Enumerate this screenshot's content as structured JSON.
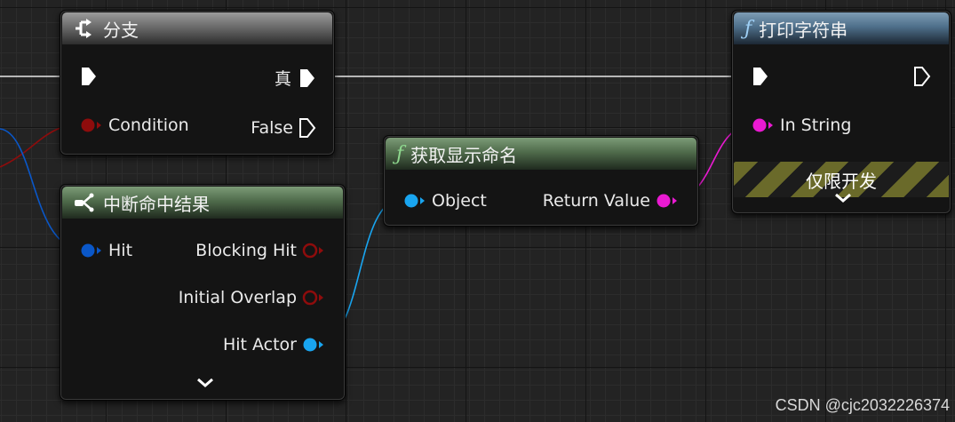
{
  "nodes": {
    "branch": {
      "title": "分支",
      "true_label": "真",
      "false_label": "False",
      "condition_label": "Condition"
    },
    "break_hit": {
      "title": "中断命中结果",
      "hit_label": "Hit",
      "blocking_hit_label": "Blocking Hit",
      "initial_overlap_label": "Initial Overlap",
      "hit_actor_label": "Hit Actor"
    },
    "get_display_name": {
      "title": "获取显示命名",
      "object_label": "Object",
      "return_value_label": "Return Value"
    },
    "print_string": {
      "title": "打印字符串",
      "in_string_label": "In String",
      "dev_only_label": "仅限开发"
    }
  },
  "icons": {
    "function": "ƒ",
    "expand": "⌄"
  },
  "colors": {
    "exec": "#ffffff",
    "bool": "#8e0c0c",
    "struct": "#0a57c8",
    "object": "#19a5f0",
    "string": "#ea1ad2"
  },
  "watermark": "CSDN @cjc2032226374"
}
